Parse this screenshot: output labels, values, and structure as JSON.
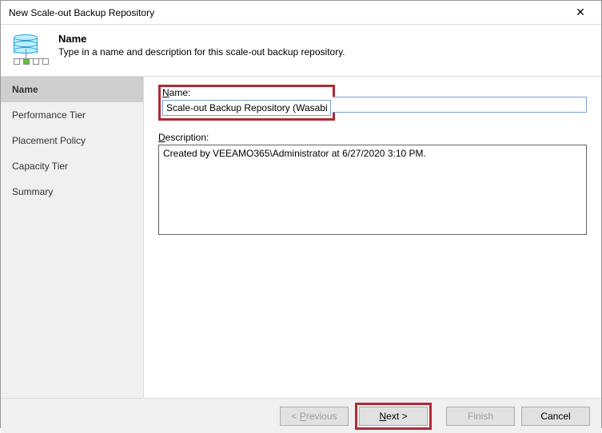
{
  "window": {
    "title": "New Scale-out Backup Repository"
  },
  "header": {
    "title": "Name",
    "subtitle": "Type in a name and description for this scale-out backup repository."
  },
  "sidebar": {
    "steps": [
      {
        "label": "Name",
        "selected": true
      },
      {
        "label": "Performance Tier",
        "selected": false
      },
      {
        "label": "Placement Policy",
        "selected": false
      },
      {
        "label": "Capacity Tier",
        "selected": false
      },
      {
        "label": "Summary",
        "selected": false
      }
    ]
  },
  "form": {
    "name_label": "Name:",
    "name_value": "Scale-out Backup Repository (Wasabi)",
    "desc_label": "Description:",
    "desc_value": "Created by VEEAMO365\\Administrator at 6/27/2020 3:10 PM."
  },
  "footer": {
    "previous": "< Previous",
    "next": "Next >",
    "finish": "Finish",
    "cancel": "Cancel"
  }
}
